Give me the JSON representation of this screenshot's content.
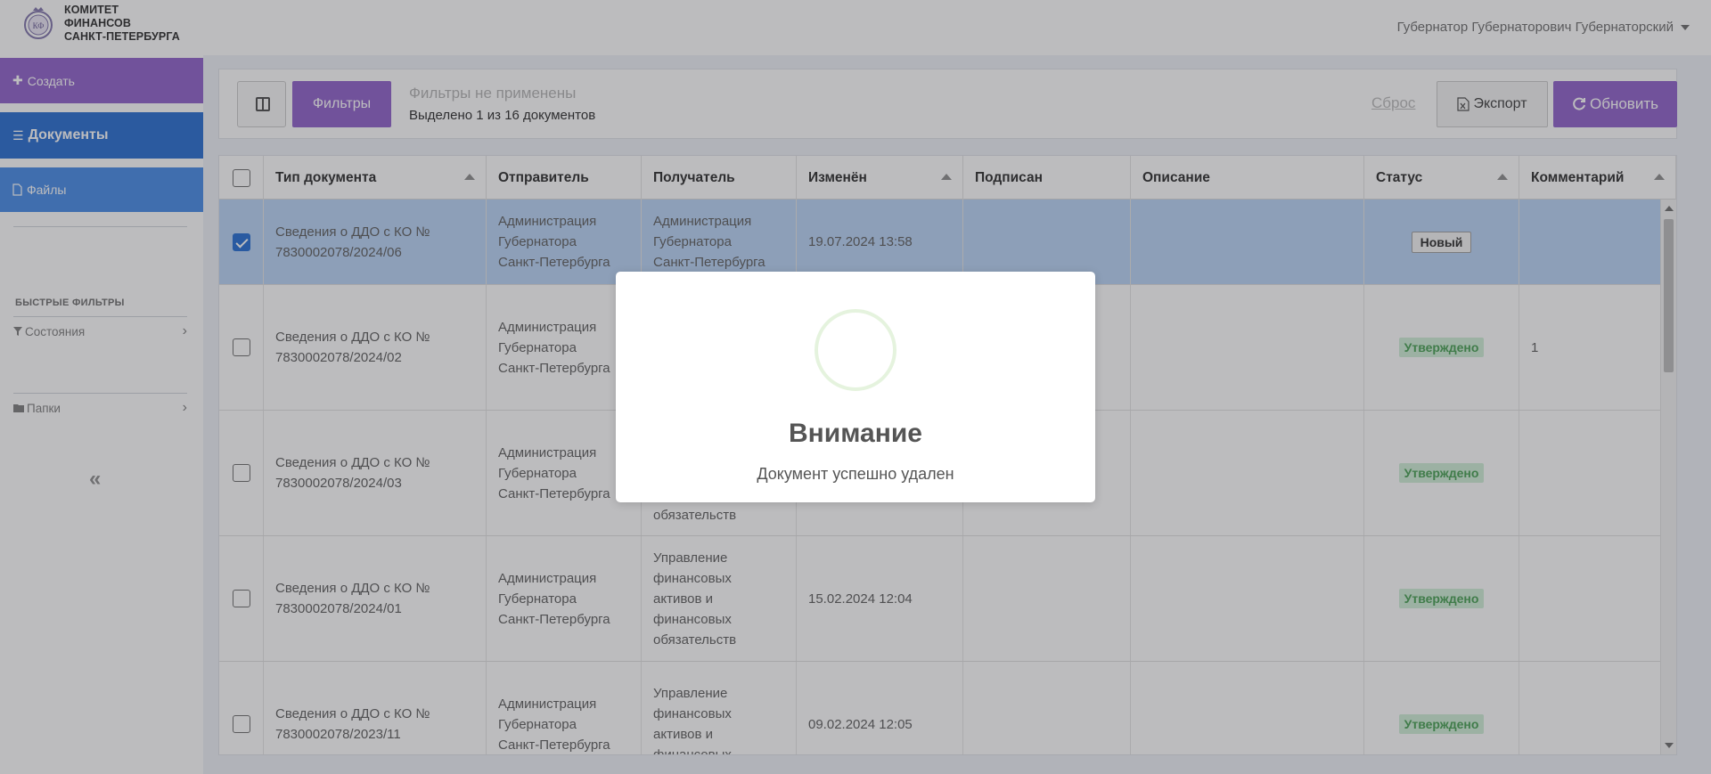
{
  "header": {
    "logo_text": "КОМИТЕТ\nФИНАНСОВ\nСАНКТ-ПЕТЕРБУРГА",
    "user_name": "Губернатор Губернаторович Губернаторский"
  },
  "sidebar": {
    "create_label": "Создать",
    "documents_label": "Документы",
    "files_label": "Файлы",
    "quick_filters_heading": "БЫСТРЫЕ ФИЛЬТРЫ",
    "states_label": "Состояния",
    "folders_label": "Папки",
    "collapse_label": "«"
  },
  "toolbar": {
    "filters_label": "Фильтры",
    "filter_status": "Фильтры не применены",
    "selection_text": "Выделено 1 из 16 документов",
    "reset_label": "Сброс",
    "export_label": "Экспорт",
    "refresh_label": "Обновить"
  },
  "table": {
    "columns": [
      "Тип документа",
      "Отправитель",
      "Получатель",
      "Изменён",
      "Подписан",
      "Описание",
      "Статус",
      "Комментарий"
    ],
    "rows": [
      {
        "selected": true,
        "type": "Сведения о ДДО с КО №\n7830002078/2024/06",
        "sender": "Администрация\nГубернатора\nСанкт-Петербурга",
        "recipient": "Администрация\nГубернатора\nСанкт-Петербурга",
        "modified": "19.07.2024 13:58",
        "signed": "",
        "description": "",
        "status": "Новый",
        "comment": ""
      },
      {
        "selected": false,
        "type": "Сведения о ДДО с КО №\n7830002078/2024/02",
        "sender": "Администрация\nГубернатора\nСанкт-Петербурга",
        "recipient": "",
        "modified": "",
        "signed": "",
        "description": "",
        "status": "Утверждено",
        "comment": "1"
      },
      {
        "selected": false,
        "type": "Сведения о ДДО с КО №\n7830002078/2024/03",
        "sender": "Администрация\nГубернатора\nСанкт-Петербурга",
        "recipient": "обязательств",
        "modified": "",
        "signed": "",
        "description": "",
        "status": "Утверждено",
        "comment": ""
      },
      {
        "selected": false,
        "type": "Сведения о ДДО с КО №\n7830002078/2024/01",
        "sender": "Администрация\nГубернатора\nСанкт-Петербурга",
        "recipient": "Управление\nфинансовых\nактивов и\nфинансовых\nобязательств",
        "modified": "15.02.2024 12:04",
        "signed": "",
        "description": "",
        "status": "Утверждено",
        "comment": ""
      },
      {
        "selected": false,
        "type": "Сведения о ДДО с КО №\n7830002078/2023/11",
        "sender": "Администрация\nГубернатора\nСанкт-Петербурга",
        "recipient": "Управление\nфинансовых\nактивов и\nфинансовых",
        "modified": "09.02.2024 12:05",
        "signed": "",
        "description": "",
        "status": "Утверждено",
        "comment": ""
      }
    ]
  },
  "modal": {
    "title": "Внимание",
    "message": "Документ успешно удален"
  },
  "colors": {
    "accent_purple": "#8a59c8",
    "documents_blue": "#1d66cf",
    "files_blue": "#3d86e7",
    "selected_row": "#b6d2f6",
    "status_ok_text": "#3e9b4a",
    "status_ok_bg": "#cdeed5"
  },
  "icons": {
    "create": "plus-icon",
    "documents": "list-icon",
    "files": "file-icon",
    "states": "filter-icon",
    "folders": "folder-icon",
    "export": "excel-icon",
    "refresh": "refresh-icon",
    "columns": "columns-icon"
  }
}
